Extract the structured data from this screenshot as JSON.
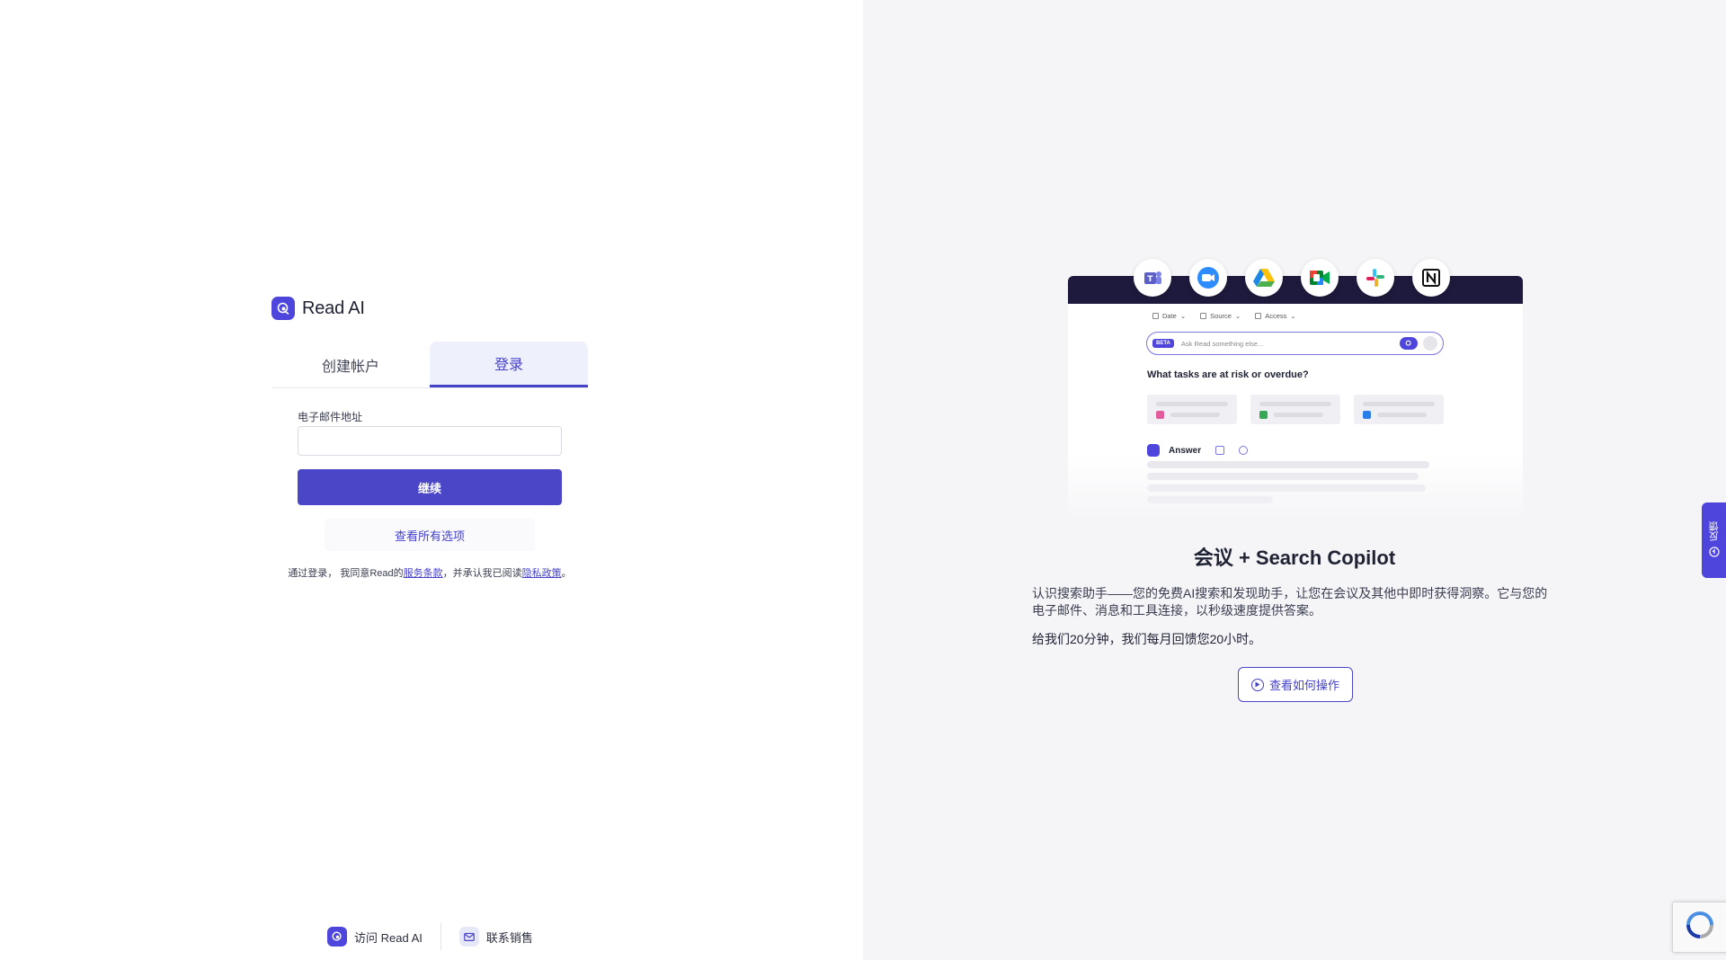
{
  "brand": {
    "name": "Read AI"
  },
  "tabs": [
    {
      "label": "创建帐户",
      "active": false
    },
    {
      "label": "登录",
      "active": true
    }
  ],
  "form": {
    "email_label": "电子邮件地址",
    "email_value": "",
    "continue_label": "继续",
    "options_label": "查看所有选项"
  },
  "terms": {
    "prefix": "通过登录， 我同意Read的",
    "tos_link": "服务条款",
    "middle": "，并承认我已阅读",
    "privacy_link": "隐私政策",
    "suffix": "。"
  },
  "footer": {
    "visit_label": "访问 Read AI",
    "sales_label": "联系销售"
  },
  "preview": {
    "apps": [
      "teams-icon",
      "zoom-icon",
      "google-drive-icon",
      "google-meet-icon",
      "slack-icon",
      "notion-icon"
    ],
    "filters": [
      "Date",
      "Source",
      "Access"
    ],
    "beta_badge": "BETA",
    "search_placeholder": "Ask Read something else...",
    "question": "What tasks are at risk or overdue?",
    "answer_label": "Answer"
  },
  "promo": {
    "title": "会议 + Search Copilot",
    "description": "认识搜索助手——您的免费AI搜索和发现助手，让您在会议及其他中即时获得洞察。它与您的电子邮件、消息和工具连接，以秒级速度提供答案。",
    "note": "给我们20分钟，我们每月回馈您20小时。",
    "howto_label": "查看如何操作"
  },
  "feedback": {
    "label": "反馈"
  },
  "colors": {
    "accent": "#4b45c8",
    "dark_bar": "#1d1a3d"
  }
}
